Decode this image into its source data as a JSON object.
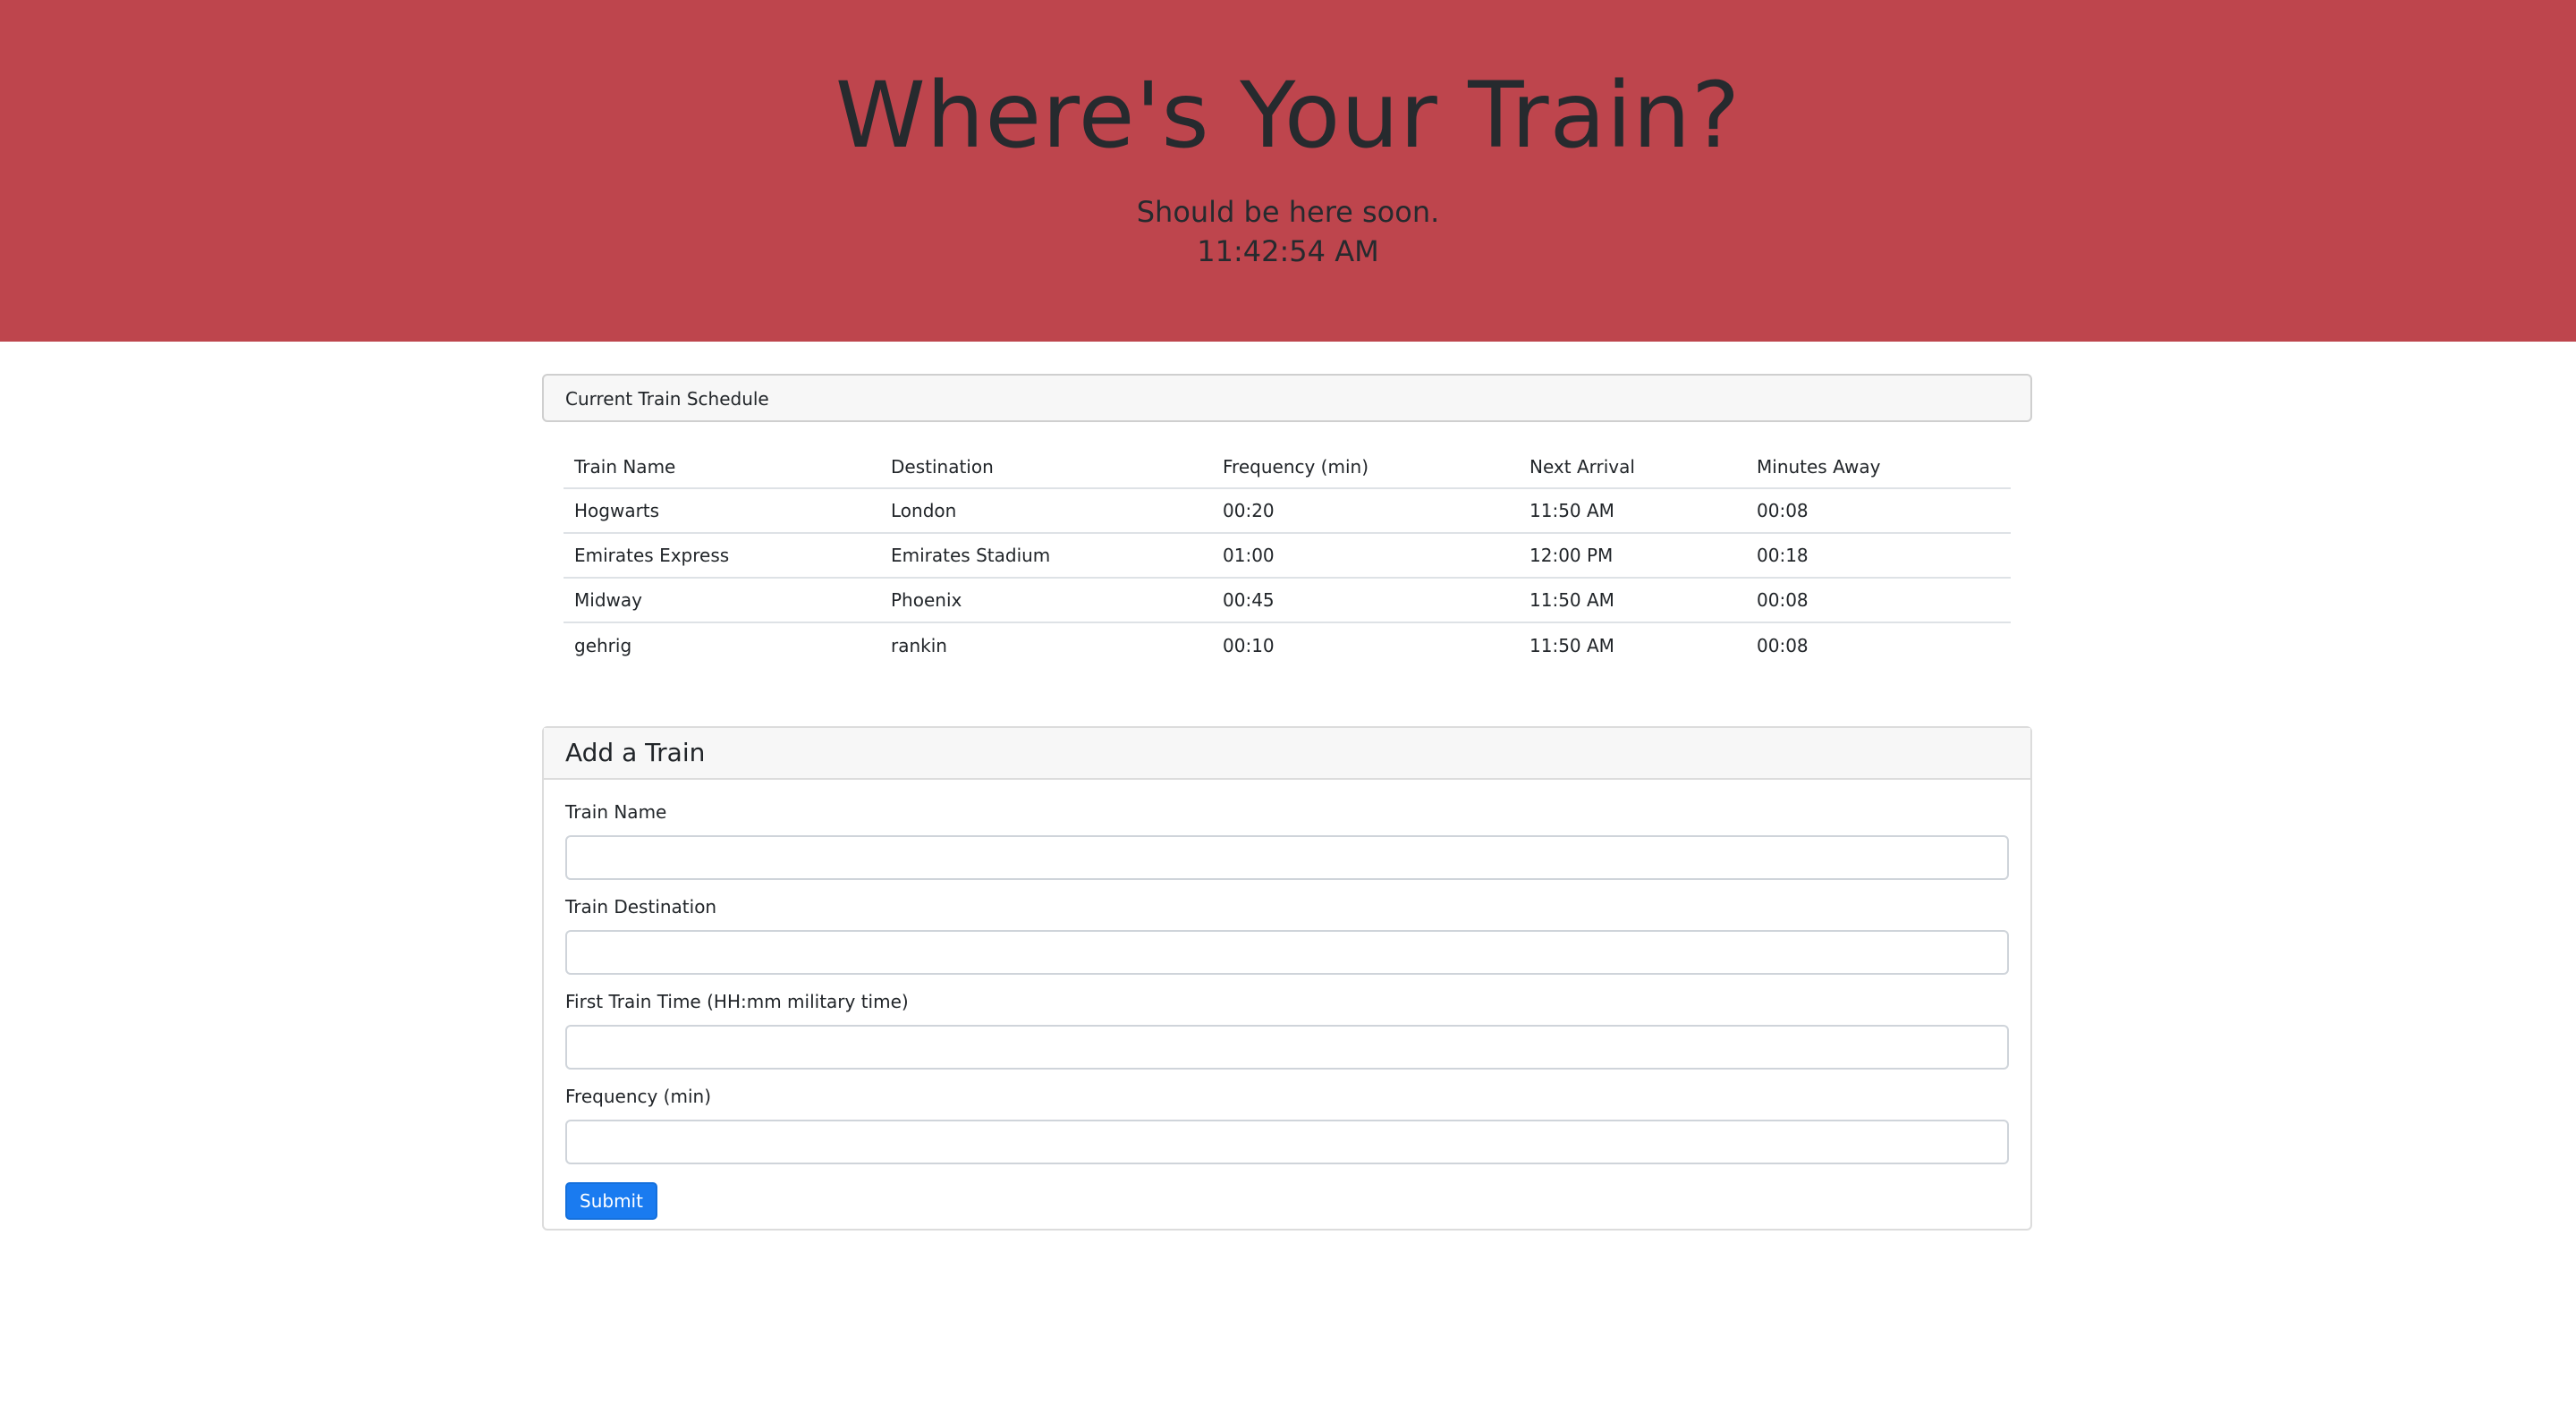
{
  "header": {
    "title": "Where's Your Train?",
    "subtitle": "Should be here soon.",
    "clock": "11:42:54 AM",
    "background": "#be454d"
  },
  "schedule": {
    "panel_title": "Current Train Schedule",
    "columns": [
      "Train Name",
      "Destination",
      "Frequency (min)",
      "Next Arrival",
      "Minutes Away"
    ],
    "rows": [
      [
        "Hogwarts",
        "London",
        "00:20",
        "11:50 AM",
        "00:08"
      ],
      [
        "Emirates Express",
        "Emirates Stadium",
        "01:00",
        "12:00 PM",
        "00:18"
      ],
      [
        "Midway",
        "Phoenix",
        "00:45",
        "11:50 AM",
        "00:08"
      ],
      [
        "gehrig",
        "rankin",
        "00:10",
        "11:50 AM",
        "00:08"
      ]
    ]
  },
  "add_train": {
    "panel_title": "Add a Train",
    "fields": [
      {
        "label": "Train Name",
        "value": "",
        "placeholder": ""
      },
      {
        "label": "Train Destination",
        "value": "",
        "placeholder": ""
      },
      {
        "label": "First Train Time (HH:mm military time)",
        "value": "",
        "placeholder": ""
      },
      {
        "label": "Frequency (min)",
        "value": "",
        "placeholder": ""
      }
    ],
    "submit_label": "Submit",
    "submit_color": "#1a7bf0"
  }
}
